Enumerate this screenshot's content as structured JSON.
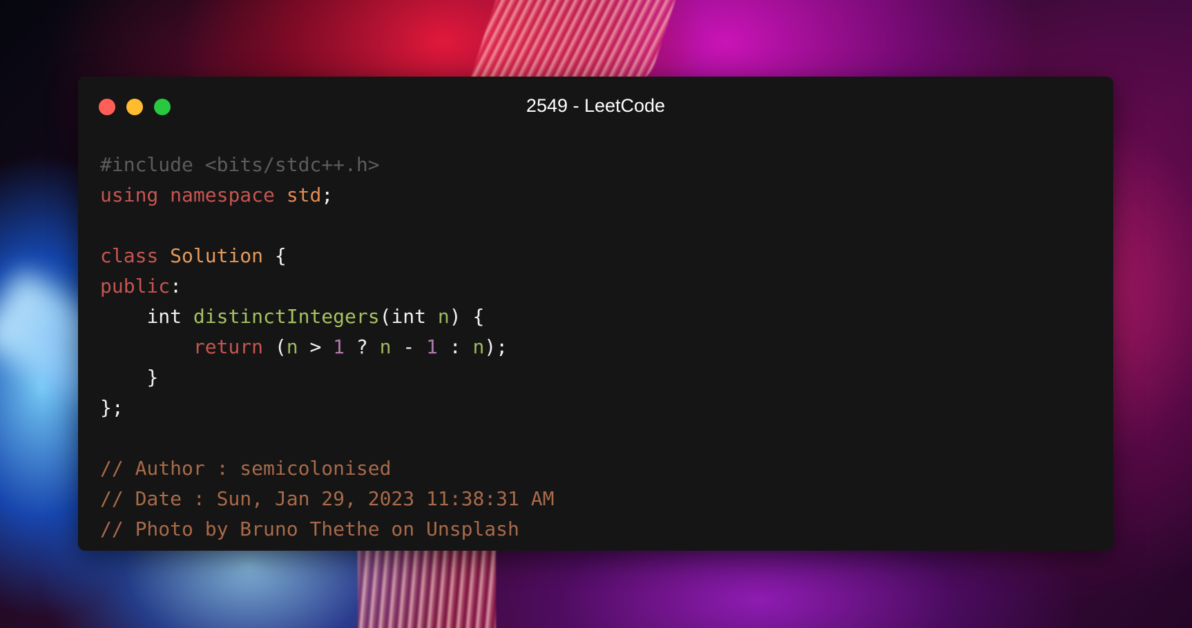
{
  "window": {
    "title": "2549 - LeetCode",
    "controls": {
      "close_color": "#ff5f57",
      "minimize_color": "#febc2e",
      "maximize_color": "#28c840"
    }
  },
  "code": {
    "include": "#include <bits/stdc++.h>",
    "using_kw": "using",
    "namespace_kw": "namespace",
    "std": "std",
    "semicolon": ";",
    "class_kw": "class",
    "class_name": "Solution",
    "open_brace": "{",
    "public_kw": "public",
    "colon": ":",
    "int_kw": "int",
    "func_name": "distinctIntegers",
    "lparen": "(",
    "param_type": "int",
    "param_name": "n",
    "rparen": ")",
    "return_kw": "return",
    "gt": ">",
    "one": "1",
    "question": "?",
    "minus": "-",
    "close_brace": "}",
    "close_class": "};",
    "end_paren_semi": ");"
  },
  "comments": {
    "author": "// Author : semicolonised",
    "date": "// Date : Sun, Jan 29, 2023 11:38:31 AM",
    "photo": "// Photo by Bruno Thethe on Unsplash"
  }
}
